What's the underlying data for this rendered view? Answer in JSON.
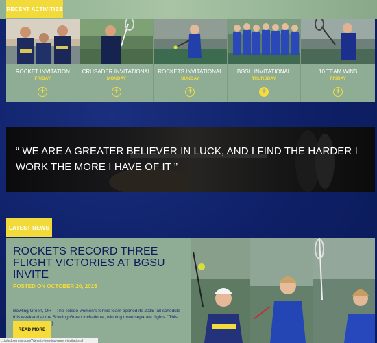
{
  "sections": {
    "recent": "RECENT ACTIVITIES",
    "news": "LATEST NEWS"
  },
  "activities": [
    {
      "label": "ROCKET INVITATION",
      "day": "FRIDAY"
    },
    {
      "label": "CRUSADER INVITATIONAL",
      "day": "MONDAY"
    },
    {
      "label": "ROCKETS INVITATIONAL",
      "day": "SUNDAY"
    },
    {
      "label": "BGSU INVITATIONAL",
      "day": "THURSDAY"
    },
    {
      "label": "10 TEAM WINS",
      "day": "FRIDAY"
    }
  ],
  "quote": "“ WE ARE A GREATER BELIEVER IN LUCK, AND I FIND THE HARDER I WORK THE MORE I HAVE OF IT ”",
  "news": {
    "title": "ROCKETS RECORD THREE FLIGHT VICTORIES AT BGSU INVITE",
    "date": "POSTED ON OCTOBER 20, 2015",
    "excerpt": "Bowling Green, OH – The Toledo women's tennis team opened its 2015 fall schedule this weekend at the Bowling Green Invitational, winning three separate flights. \"This was a very solid […]",
    "read_more": "READ MORE"
  },
  "status_url": "...toledotennis.com/?/tennis-bowling-green-invitational",
  "colors": {
    "navy": "#0c1d5e",
    "sage": "#8fac95",
    "gold": "#f5dc3a"
  }
}
